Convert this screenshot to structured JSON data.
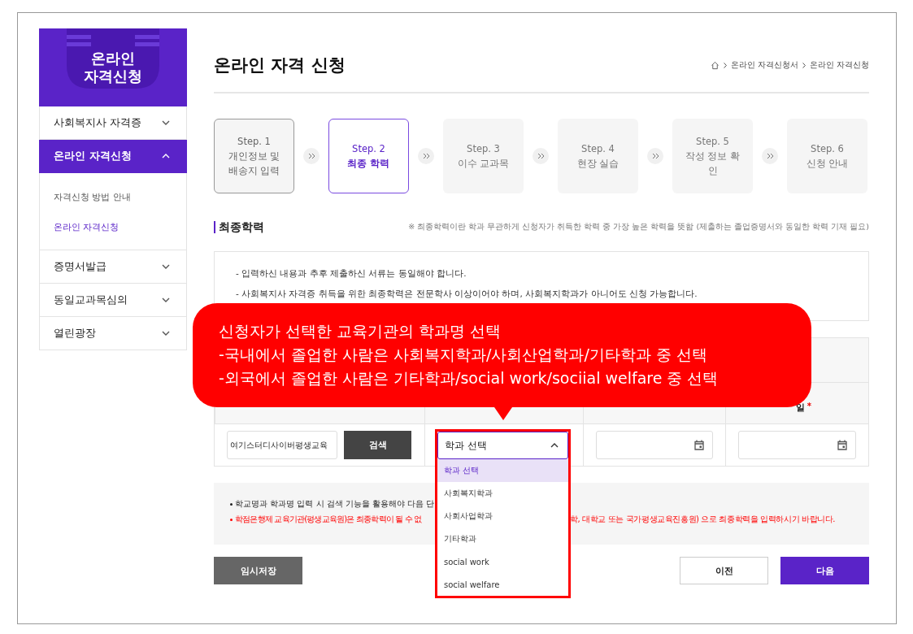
{
  "sidebar": {
    "logo": "온라인 자격신청",
    "menu": [
      {
        "label": "사회복지사 자격증",
        "expanded": false
      },
      {
        "label": "온라인 자격신청",
        "expanded": true,
        "children": [
          {
            "label": "자격신청 방법 안내",
            "selected": false
          },
          {
            "label": "온라인 자격신청",
            "selected": true
          }
        ]
      },
      {
        "label": "증명서발급",
        "expanded": false
      },
      {
        "label": "동일교과목심의",
        "expanded": false
      },
      {
        "label": "열린광장",
        "expanded": false
      }
    ]
  },
  "header": {
    "title": "온라인 자격 신청",
    "breadcrumb": [
      "온라인 자격신청서",
      "온라인 자격신청"
    ]
  },
  "steps": [
    {
      "step": "Step. 1",
      "label": "개인정보 및 배송지 입력",
      "completed": true,
      "selected": false
    },
    {
      "step": "Step. 2",
      "label": "최종 학력",
      "completed": false,
      "selected": true
    },
    {
      "step": "Step. 3",
      "label": "이수 교과목",
      "completed": false,
      "selected": false
    },
    {
      "step": "Step. 4",
      "label": "현장 실습",
      "completed": false,
      "selected": false
    },
    {
      "step": "Step. 5",
      "label": "작성 정보 확인",
      "completed": false,
      "selected": false
    },
    {
      "step": "Step. 6",
      "label": "신청 안내",
      "completed": false,
      "selected": false
    }
  ],
  "section": {
    "title": "최종학력",
    "note": "※ 최종학력이란 학과 무관하게 신청자가 취득한 학력 중 가장 높은 학력을 뜻함 (제출하는 졸업증명서와 동일한 학력 기재 필요)"
  },
  "notices": [
    "- 입력하신 내용과 추후 제출하신 서류는 동일해야 합니다.",
    "- 사회복지사 자격증 취득을 위한 최종학력은 전문학사 이상이어야 하며, 사회복지학과가 아니어도 신청 가능합니다."
  ],
  "table": {
    "column_4_header": "일",
    "column_4_required": "*",
    "row": {
      "school": "여기스터디사이버평생교육",
      "search_button": "검색",
      "department": {
        "value": "학과 선택",
        "open": true,
        "options": [
          {
            "label": "학과 선택",
            "selected": true
          },
          {
            "label": "사회복지학과",
            "selected": false
          },
          {
            "label": "사회사업학과",
            "selected": false
          },
          {
            "label": "기타학과",
            "selected": false
          },
          {
            "label": "social work",
            "selected": false
          },
          {
            "label": "social welfare",
            "selected": false
          }
        ]
      },
      "date_fields": [
        {
          "kind": "date"
        },
        {
          "kind": "date"
        }
      ]
    }
  },
  "tips": [
    {
      "kind": "info",
      "parts": [
        "학교명과 학과명 입력 시 검색 기능을 활용해야 다음 단"
      ]
    },
    {
      "kind": "warning",
      "parts": [
        "학점은행제 교육기관(평생교육원)은 최종학력이 될 수 없",
        "학, 대학교 또는 국가평생교육진흥원) 으로 최종학력을 입력하시기 바랍니다."
      ]
    }
  ],
  "buttons": [
    {
      "label": "임시저장",
      "kind": "save"
    },
    {
      "label": "이전",
      "kind": "prev"
    },
    {
      "label": "다음",
      "kind": "next"
    }
  ],
  "callout": {
    "lines": [
      "신청자가 선택한 교육기관의 학과명 선택",
      "-국내에서 졸업한 사람은 사회복지학과/사회산업학과/기타학과 중 선택",
      "-외국에서 졸업한 사람은 기타학과/social work/sociial welfare 중 선택"
    ]
  }
}
